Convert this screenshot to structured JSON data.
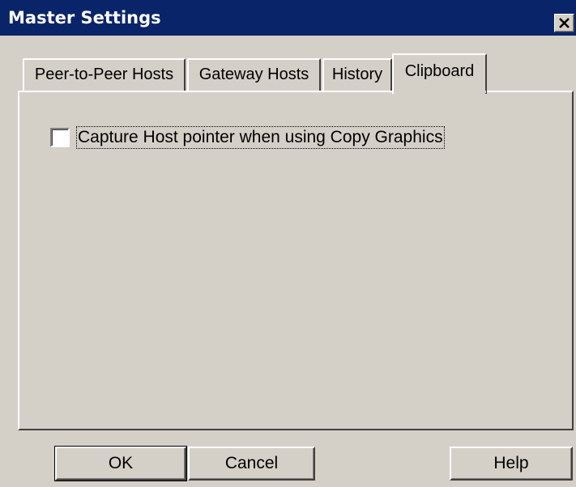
{
  "window": {
    "title": "Master Settings",
    "close_symbol": "✕"
  },
  "tabs": [
    {
      "label": "Peer-to-Peer Hosts",
      "selected": false
    },
    {
      "label": "Gateway Hosts",
      "selected": false
    },
    {
      "label": "History",
      "selected": false
    },
    {
      "label": "Clipboard",
      "selected": true
    }
  ],
  "clipboard": {
    "capture_pointer": {
      "label": "Capture Host pointer when using Copy Graphics",
      "checked": false
    }
  },
  "buttons": {
    "ok": "OK",
    "cancel": "Cancel",
    "help": "Help"
  },
  "colors": {
    "title_bar": "#0a246a",
    "face": "#d4d0c8"
  },
  "icons": {
    "close": "close-icon"
  }
}
